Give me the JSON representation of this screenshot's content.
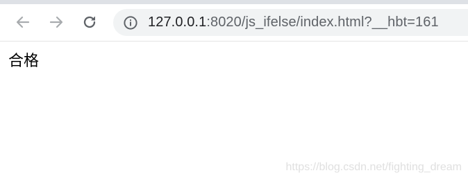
{
  "browser": {
    "url_host": "127.0.0.1",
    "url_rest": ":8020/js_ifelse/index.html?__hbt=161",
    "icons": {
      "back": "back-arrow-icon",
      "forward": "forward-arrow-icon",
      "reload": "reload-icon",
      "site_info": "info-icon"
    }
  },
  "page": {
    "body_text": "合格"
  },
  "watermark": {
    "text": "https://blog.csdn.net/fighting_dream"
  },
  "colors": {
    "icon_gray": "#5f6368",
    "icon_disabled": "#a8abae",
    "omnibox_bg": "#f1f3f4"
  }
}
